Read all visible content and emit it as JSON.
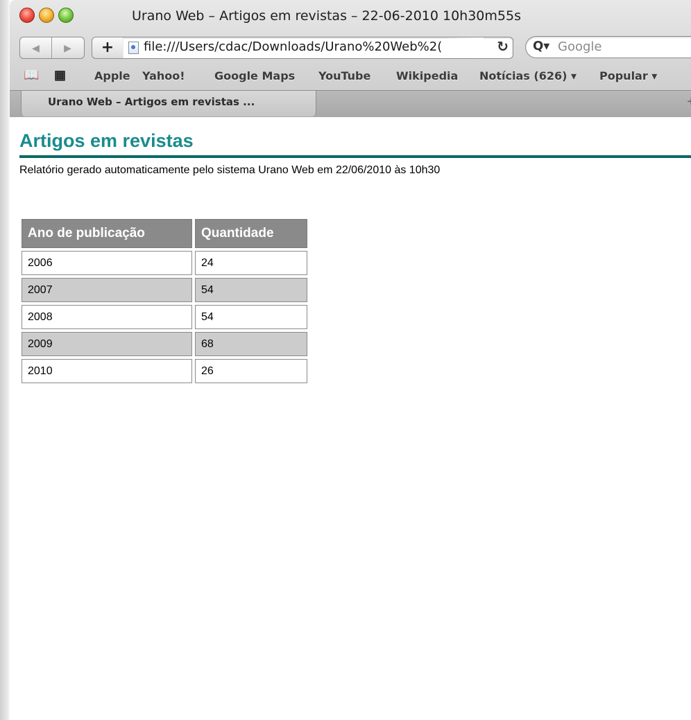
{
  "window": {
    "title": "Urano Web – Artigos em revistas – 22-06-2010 10h30m55s"
  },
  "navbar": {
    "back_label": "◀",
    "forward_label": "▶",
    "add_label": "+",
    "url": "file:///Users/cdac/Downloads/Urano%20Web%2(",
    "reload_label": "↻",
    "search_icon_label": "Q▾",
    "search_placeholder": "Google"
  },
  "bookmarks": {
    "book_icon": "book-icon",
    "grid_icon": "grid-icon",
    "items": [
      "Apple",
      "Yahoo!",
      "Google Maps",
      "YouTube",
      "Wikipedia",
      "Notícias (626) ▾",
      "Popular ▾"
    ]
  },
  "tabs": [
    {
      "label": "Urano Web – Artigos em revistas ..."
    }
  ],
  "new_tab_label": "+",
  "page": {
    "title": "Artigos em revistas",
    "subtitle": "Relatório gerado automaticamente pelo sistema Urano Web em 22/06/2010 às 10h30",
    "title_color": "#1a8c8c",
    "rule_color": "#0b6a66"
  },
  "table": {
    "headers": [
      "Ano de publicação",
      "Quantidade"
    ],
    "rows": [
      {
        "year": "2006",
        "qty": "24"
      },
      {
        "year": "2007",
        "qty": "54"
      },
      {
        "year": "2008",
        "qty": "54"
      },
      {
        "year": "2009",
        "qty": "68"
      },
      {
        "year": "2010",
        "qty": "26"
      }
    ]
  }
}
